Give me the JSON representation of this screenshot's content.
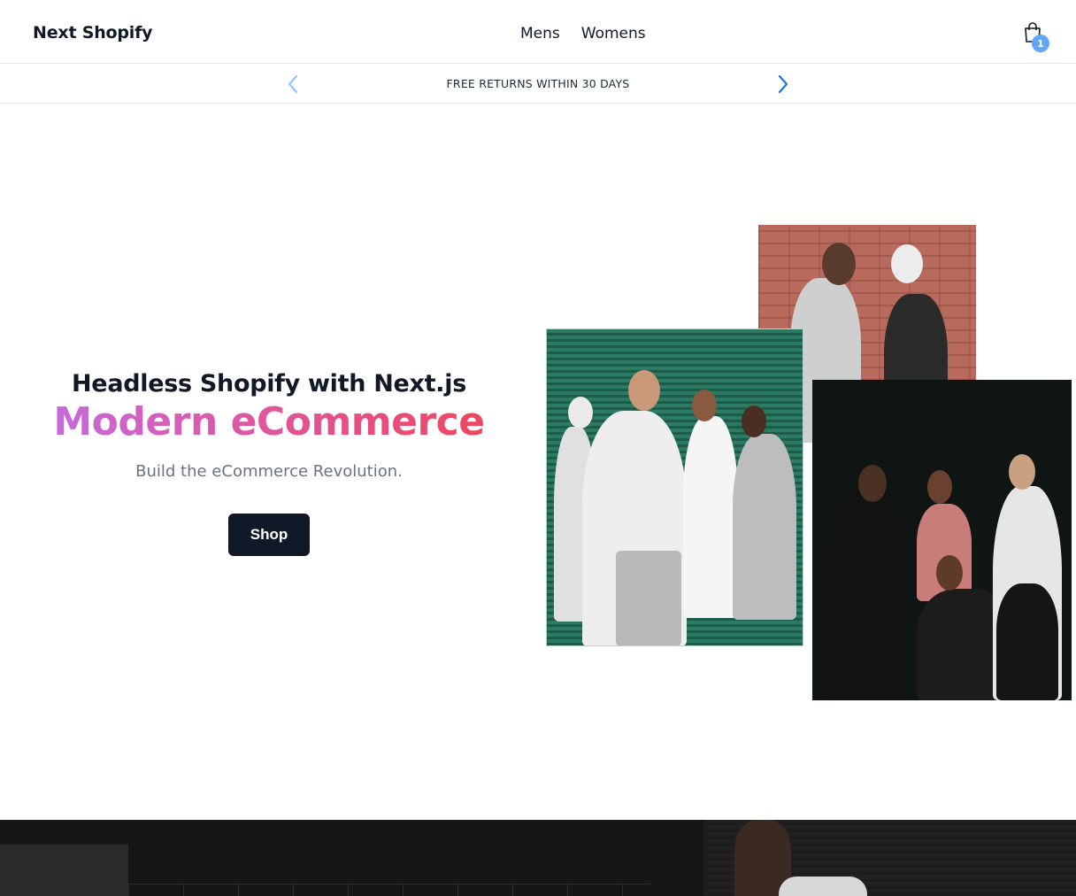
{
  "header": {
    "logo": "Next Shopify",
    "nav": [
      "Mens",
      "Womens"
    ],
    "cart_count": "1",
    "cart_icon": "shopping-bag-icon"
  },
  "announcement": {
    "text": "FREE RETURNS WITHIN 30 DAYS",
    "prev_icon": "chevron-left-icon",
    "next_icon": "chevron-right-icon"
  },
  "hero": {
    "eyebrow": "Headless Shopify with Next.js",
    "title": "Modern eCommerce",
    "subtitle": "Build the eCommerce Revolution.",
    "cta": "Shop"
  },
  "colors": {
    "accent_gradient_start": "#c46be0",
    "accent_gradient_end": "#f0455a",
    "button_bg": "#111827",
    "badge_bg": "#60a5fa"
  }
}
